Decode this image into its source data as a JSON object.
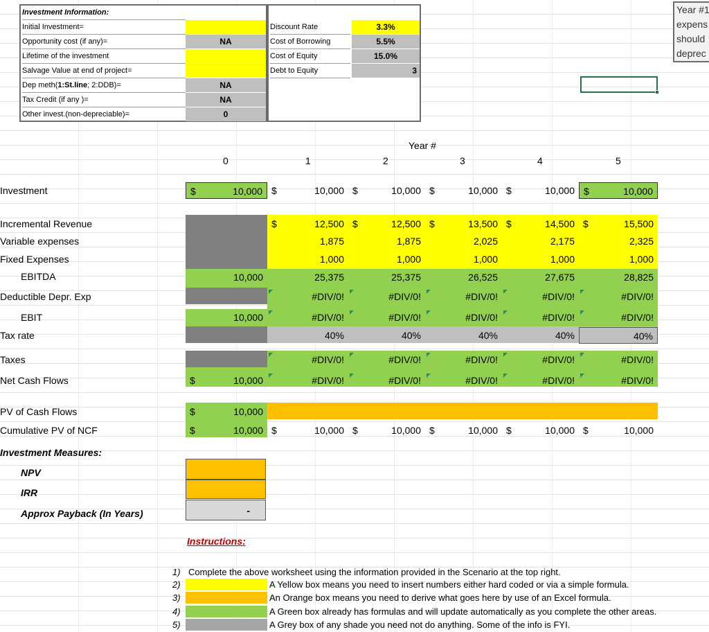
{
  "info": {
    "title": "Investment Information:",
    "labels": [
      "Initial Investment=",
      "Opportunity cost (if any)=",
      "Lifetime of the investment",
      "Salvage Value at end of project=",
      "Dep meth(1:St.line; 2:DDB)=",
      "Tax Credit (if any )=",
      "Other invest.(non-depreciable)="
    ],
    "dep_label_prefix": "Dep meth(",
    "dep_label_bold": "1:St.line",
    "dep_label_suffix": "; 2:DDB)=",
    "values": [
      "",
      "NA",
      "",
      "",
      "NA",
      "NA",
      "0"
    ]
  },
  "rates": {
    "labels": [
      "Discount Rate",
      "Cost of Borrowing",
      "Cost of Equity",
      "Debt to Equity"
    ],
    "values": [
      "3.3%",
      "5.5%",
      "15.0%",
      "3"
    ]
  },
  "scenario": {
    "lines": [
      "Year #1",
      "expens",
      "should",
      "deprec"
    ]
  },
  "year_header": "Year #",
  "years": [
    "0",
    "1",
    "2",
    "3",
    "4",
    "5"
  ],
  "currency": "$",
  "rows": {
    "investment": {
      "label": "Investment",
      "values": [
        "10,000",
        "10,000",
        "10,000",
        "10,000",
        "10,000",
        "10,000"
      ]
    },
    "revenue": {
      "label": "Incremental Revenue",
      "values": [
        "",
        "12,500",
        "12,500",
        "13,500",
        "14,500",
        "15,500"
      ]
    },
    "variable": {
      "label": "Variable expenses",
      "values": [
        "",
        "1,875",
        "1,875",
        "2,025",
        "2,175",
        "2,325"
      ]
    },
    "fixed": {
      "label": "Fixed Expenses",
      "values": [
        "",
        "1,000",
        "1,000",
        "1,000",
        "1,000",
        "1,000"
      ]
    },
    "ebitda": {
      "label": "EBITDA",
      "values": [
        "10,000",
        "25,375",
        "25,375",
        "26,525",
        "27,675",
        "28,825"
      ]
    },
    "depr": {
      "label": "Deductible Depr. Exp",
      "values": [
        "",
        "#DIV/0!",
        "#DIV/0!",
        "#DIV/0!",
        "#DIV/0!",
        "#DIV/0!"
      ]
    },
    "ebit": {
      "label": "EBIT",
      "values": [
        "10,000",
        "#DIV/0!",
        "#DIV/0!",
        "#DIV/0!",
        "#DIV/0!",
        "#DIV/0!"
      ]
    },
    "tax": {
      "label": "Tax rate",
      "values": [
        "",
        "40%",
        "40%",
        "40%",
        "40%",
        "40%"
      ]
    },
    "taxes": {
      "label": "Taxes",
      "values": [
        "",
        "#DIV/0!",
        "#DIV/0!",
        "#DIV/0!",
        "#DIV/0!",
        "#DIV/0!"
      ]
    },
    "ncf": {
      "label": "Net Cash Flows",
      "values": [
        "10,000",
        "#DIV/0!",
        "#DIV/0!",
        "#DIV/0!",
        "#DIV/0!",
        "#DIV/0!"
      ]
    },
    "pv": {
      "label": "PV of Cash Flows",
      "values": [
        "10,000"
      ]
    },
    "cumpv": {
      "label": "Cumulative PV of NCF",
      "values": [
        "10,000",
        "10,000",
        "10,000",
        "10,000",
        "10,000",
        "10,000"
      ]
    }
  },
  "measures": {
    "title": "Investment Measures:",
    "npv": "NPV",
    "irr": "IRR",
    "payback": "Approx Payback (In Years)",
    "payback_value": "-"
  },
  "instructions": {
    "title": "Instructions:",
    "items": [
      {
        "num": "1)",
        "text": "Complete the above worksheet using the information provided in the Scenario at the top right."
      },
      {
        "num": "2)",
        "text": "A Yellow box means you need to insert numbers either hard coded or via a simple formula."
      },
      {
        "num": "3)",
        "text": "An Orange box means you need to derive what goes here by use of an Excel formula."
      },
      {
        "num": "4)",
        "text": "A Green box already has formulas and will update automatically as you complete the other areas."
      },
      {
        "num": "5)",
        "text": "A Grey box of any shade you need not do anything.  Some of the info is FYI."
      }
    ]
  },
  "colors": {
    "yellow": "#ffff00",
    "orange": "#ffc000",
    "green": "#92d050",
    "grey": "#bfbfbf",
    "dark_grey": "#808080"
  }
}
